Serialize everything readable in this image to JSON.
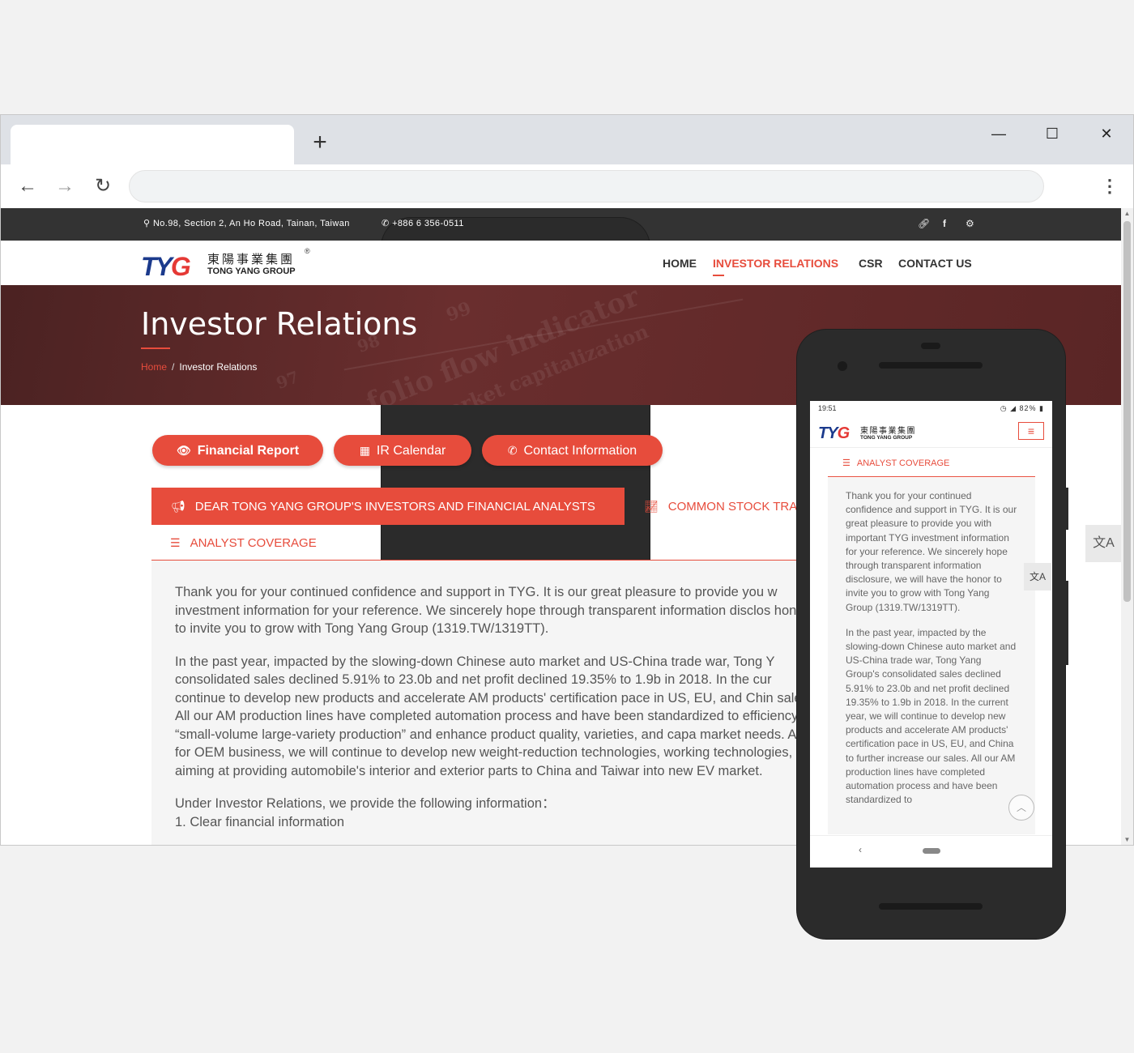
{
  "browser": {
    "new_tab_glyph": "+",
    "minimize_glyph": "—",
    "maximize_glyph": "☐",
    "close_glyph": "✕",
    "back_glyph": "←",
    "forward_glyph": "→",
    "reload_glyph": "↻",
    "menu_glyph": "⋮",
    "address_value": ""
  },
  "topbar": {
    "address": "No.98, Section 2, An Ho Road, Tainan, Taiwan",
    "phone": "+886 6 356-0511",
    "icons": [
      "link-icon",
      "facebook-icon",
      "gear-icon"
    ]
  },
  "logo": {
    "mark_ty": "TY",
    "mark_g": "G",
    "chinese": "東陽事業集團",
    "english": "TONG YANG GROUP",
    "registered": "®"
  },
  "nav": {
    "items": [
      {
        "label": "HOME",
        "active": false
      },
      {
        "label": "INVESTOR RELATIONS",
        "active": true
      },
      {
        "label": "CSR",
        "active": false
      },
      {
        "label": "CONTACT US",
        "active": false
      }
    ]
  },
  "banner": {
    "title": "Investor Relations",
    "breadcrumb_home": "Home",
    "breadcrumb_sep": "/",
    "breadcrumb_current": "Investor Relations",
    "bg_words": [
      "folio flow indicator",
      "market capitalization",
      "99",
      "98",
      "97"
    ]
  },
  "actions": {
    "financial_report": "Financial Report",
    "ir_calendar": "IR Calendar",
    "contact_information": "Contact Information"
  },
  "tabs": {
    "dear": "DEAR TONG YANG GROUP'S INVESTORS AND FINANCIAL ANALYSTS",
    "common_stock": "COMMON STOCK TRA",
    "analyst_coverage": "ANALYST COVERAGE"
  },
  "content": {
    "p1": "Thank you for your continued confidence and support in TYG. It is our great pleasure to provide you w investment information for your reference. We sincerely hope through transparent information disclos honor to invite you to grow with Tong Yang Group (1319.TW/1319TT).",
    "p2": "In the past year, impacted by the slowing-down Chinese auto market and US-China trade war, Tong Y consolidated sales declined 5.91% to 23.0b and net profit declined 19.35% to 1.9b in 2018. In the cur continue to develop new products and accelerate AM products' certification pace in US, EU, and Chin sales. All our AM production lines have completed automation process and have been standardized to efficiency of “small-volume large-variety production” and enhance product quality, varieties, and capa market needs. As for OEM business, we will continue to develop new weight-reduction technologies, working technologies, aiming at providing automobile's interior and exterior parts to China and Taiwar into new EV market.",
    "p3": "Under Investor Relations, we provide the following information：",
    "p4": "1. Clear financial information"
  },
  "mobile": {
    "time": "19:51",
    "battery": "82%",
    "tab": "ANALYST COVERAGE",
    "p1": "Thank you for your continued confidence and support in TYG. It is our great pleasure to provide you with important TYG investment information for your reference. We sincerely hope through transparent information disclosure, we will have the honor to invite you to grow with Tong Yang Group (1319.TW/1319TT).",
    "p2": "In the past year, impacted by the slowing-down Chinese auto market and US-China trade war, Tong Yang Group's consolidated sales declined 5.91% to 23.0b and net profit declined 19.35% to 1.9b in 2018. In the current year, we will continue to develop new products and accelerate AM products' certification pace in US, EU, and China to further increase our sales. All our AM production lines have completed automation process and have been standardized to"
  },
  "colors": {
    "accent": "#e74c3c",
    "topbar": "#333333",
    "brand_blue": "#1b3a8c"
  }
}
